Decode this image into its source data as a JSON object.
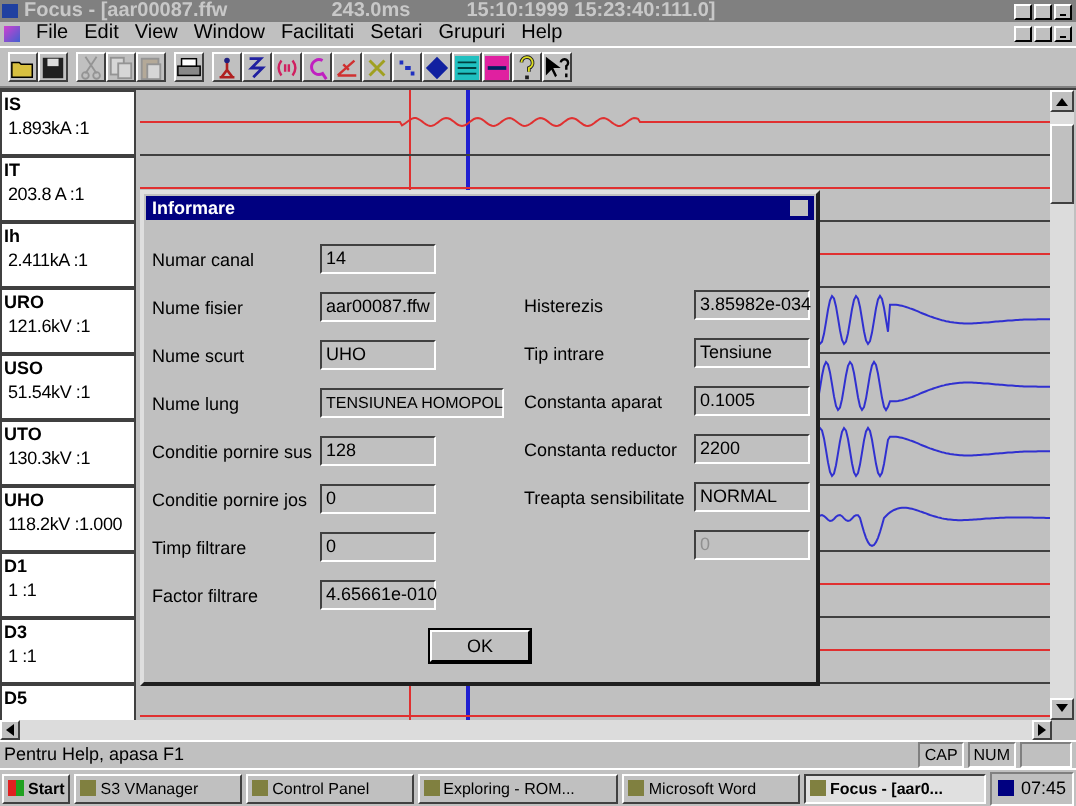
{
  "window": {
    "title": "Focus - [aar00087.ffw",
    "duration": "243.0ms",
    "timestamp": "15:10:1999 15:23:40:111.0]"
  },
  "menu": [
    "File",
    "Edit",
    "View",
    "Window",
    "Facilitati",
    "Setari",
    "Grupuri",
    "Help"
  ],
  "toolbar": [
    {
      "kind": "folder",
      "disabled": false
    },
    {
      "kind": "floppy",
      "disabled": false
    },
    {
      "kind": "scissors",
      "disabled": true
    },
    {
      "kind": "pages",
      "disabled": true
    },
    {
      "kind": "clipboard",
      "disabled": true
    },
    {
      "kind": "printer",
      "disabled": false
    },
    {
      "kind": "figure",
      "disabled": false
    },
    {
      "kind": "zigzag",
      "disabled": false
    },
    {
      "kind": "brackets",
      "disabled": false
    },
    {
      "kind": "hook",
      "disabled": false
    },
    {
      "kind": "angle",
      "disabled": false
    },
    {
      "kind": "cross",
      "disabled": false
    },
    {
      "kind": "dots",
      "disabled": false
    },
    {
      "kind": "diamond",
      "disabled": false
    },
    {
      "kind": "grid",
      "disabled": false
    },
    {
      "kind": "bars",
      "disabled": false
    },
    {
      "kind": "help",
      "disabled": false
    },
    {
      "kind": "context-help",
      "disabled": false
    }
  ],
  "channels": [
    {
      "name": "IS",
      "scale": "1.893kA :1",
      "kind": "ripple"
    },
    {
      "name": "IT",
      "scale": "203.8 A :1",
      "kind": "flat"
    },
    {
      "name": "Ih",
      "scale": "2.411kA :1",
      "kind": "flat"
    },
    {
      "name": "URO",
      "scale": "121.6kV :1",
      "kind": "burst"
    },
    {
      "name": "USO",
      "scale": "51.54kV :1",
      "kind": "burst"
    },
    {
      "name": "UTO",
      "scale": "130.3kV :1",
      "kind": "burst"
    },
    {
      "name": "UHO",
      "scale": "118.2kV :1.000",
      "kind": "spike"
    },
    {
      "name": "D1",
      "scale": "1 :1",
      "kind": "flat"
    },
    {
      "name": "D3",
      "scale": "1 :1",
      "kind": "flat"
    },
    {
      "name": "D5",
      "kind": "flat"
    }
  ],
  "dialog": {
    "title": "Informare",
    "fields_left": [
      {
        "label": "Numar canal",
        "value": "14"
      },
      {
        "label": "Nume fisier",
        "value": "aar00087.ffw"
      },
      {
        "label": "Nume scurt",
        "value": "UHO"
      },
      {
        "label": "Nume lung",
        "value": "TENSIUNEA HOMOPOL"
      },
      {
        "label": "Conditie pornire sus",
        "value": "128"
      },
      {
        "label": "Conditie pornire jos",
        "value": "0"
      },
      {
        "label": "Timp filtrare",
        "value": "0"
      },
      {
        "label": "Factor filtrare",
        "value": "4.65661e-010"
      }
    ],
    "fields_right": [
      {
        "label": "Histerezis",
        "value": "3.85982e-034",
        "disabled": false
      },
      {
        "label": "Tip intrare",
        "value": "Tensiune",
        "disabled": false
      },
      {
        "label": "Constanta aparat",
        "value": "0.1005",
        "disabled": false
      },
      {
        "label": "Constanta reductor",
        "value": "2200",
        "disabled": false
      },
      {
        "label": "Treapta sensibilitate",
        "value": "NORMAL",
        "disabled": false
      },
      {
        "value": "0",
        "disabled": true
      }
    ],
    "ok_button": "OK"
  },
  "status_bar": {
    "text": "Pentru Help, apasa F1",
    "indicators": [
      "CAP",
      "NUM"
    ]
  },
  "taskbar": {
    "start": "Start",
    "items": [
      {
        "label": "S3 VManager",
        "selected": false
      },
      {
        "label": "Control Panel",
        "selected": false
      },
      {
        "label": "Exploring - ROM...",
        "selected": false
      },
      {
        "label": "Microsoft Word",
        "selected": false
      },
      {
        "label": "Focus - [aar0...",
        "selected": true
      }
    ],
    "clock": "07:45"
  }
}
